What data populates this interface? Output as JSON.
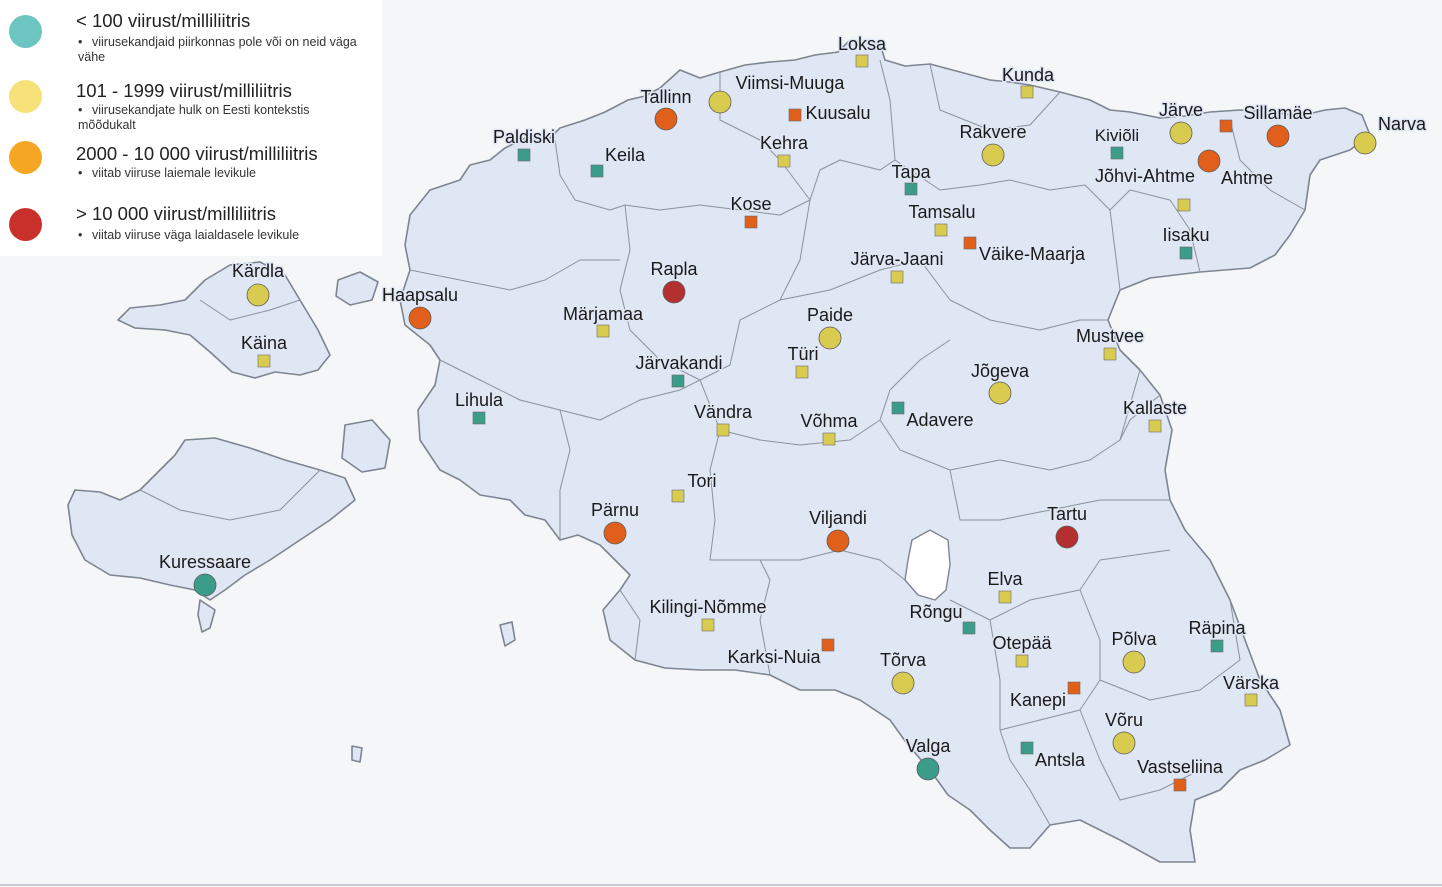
{
  "legend": {
    "items": [
      {
        "title": "< 100 viirust/milliliitris",
        "desc": "viirusekandjaid piirkonnas pole või on neid väga vähe",
        "color": "#6cc5c1"
      },
      {
        "title": "101 - 1999 viirust/milliliitris",
        "desc": "viirusekandjate hulk on Eesti kontekstis mõõdukalt",
        "color": "#f7e27a"
      },
      {
        "title": "2000 - 10 000 viirust/milliliitris",
        "desc": "viitab viiruse laiemale levikule",
        "color": "#f5a623"
      },
      {
        "title": "> 10 000 viirust/milliliitris",
        "desc": "viitab viiruse väga laialdasele levikule",
        "color": "#c9302c"
      }
    ]
  },
  "marker_colors": {
    "teal": "#3c9c8a",
    "yellow": "#d9cb4f",
    "orange": "#e05f1b",
    "red": "#b3302f"
  },
  "cities": [
    {
      "name": "Loksa",
      "marker": "square",
      "level": "yellow"
    },
    {
      "name": "Viimsi-Muuga",
      "marker": "circle",
      "level": "yellow"
    },
    {
      "name": "Kunda",
      "marker": "square",
      "level": "yellow"
    },
    {
      "name": "Tallinn",
      "marker": "circle",
      "level": "orange"
    },
    {
      "name": "Kuusalu",
      "marker": "square",
      "level": "orange"
    },
    {
      "name": "Järve",
      "marker": "circle",
      "level": "yellow"
    },
    {
      "name": "Sillamäe",
      "marker": "circle",
      "level": "orange"
    },
    {
      "name": "Narva",
      "marker": "circle",
      "level": "yellow"
    },
    {
      "name": "Paldiski",
      "marker": "square",
      "level": "teal"
    },
    {
      "name": "Kehra",
      "marker": "square",
      "level": "yellow"
    },
    {
      "name": "Rakvere",
      "marker": "circle",
      "level": "yellow"
    },
    {
      "name": "Kiviõli",
      "marker": "square",
      "level": "teal"
    },
    {
      "name": "Keila",
      "marker": "square",
      "level": "teal"
    },
    {
      "name": "Tapa",
      "marker": "square",
      "level": "teal"
    },
    {
      "name": "Jõhvi-Ahtme",
      "marker": "square",
      "level": "yellow"
    },
    {
      "name": "Ahtme",
      "marker": "circle",
      "level": "orange"
    },
    {
      "name": "Kose",
      "marker": "square",
      "level": "orange"
    },
    {
      "name": "Tamsalu",
      "marker": "square",
      "level": "yellow"
    },
    {
      "name": "Iisaku",
      "marker": "square",
      "level": "teal"
    },
    {
      "name": "Väike-Maarja",
      "marker": "square",
      "level": "orange"
    },
    {
      "name": "Järva-Jaani",
      "marker": "square",
      "level": "yellow"
    },
    {
      "name": "Rapla",
      "marker": "circle",
      "level": "red"
    },
    {
      "name": "Kärdla",
      "marker": "circle",
      "level": "yellow"
    },
    {
      "name": "Haapsalu",
      "marker": "circle",
      "level": "orange"
    },
    {
      "name": "Märjamaa",
      "marker": "square",
      "level": "yellow"
    },
    {
      "name": "Paide",
      "marker": "circle",
      "level": "yellow"
    },
    {
      "name": "Käina",
      "marker": "square",
      "level": "yellow"
    },
    {
      "name": "Mustvee",
      "marker": "square",
      "level": "yellow"
    },
    {
      "name": "Türi",
      "marker": "square",
      "level": "yellow"
    },
    {
      "name": "Järvakandi",
      "marker": "square",
      "level": "teal"
    },
    {
      "name": "Jõgeva",
      "marker": "circle",
      "level": "yellow"
    },
    {
      "name": "Lihula",
      "marker": "square",
      "level": "teal"
    },
    {
      "name": "Kallaste",
      "marker": "square",
      "level": "yellow"
    },
    {
      "name": "Vändra",
      "marker": "square",
      "level": "yellow"
    },
    {
      "name": "Adavere",
      "marker": "square",
      "level": "teal"
    },
    {
      "name": "Võhma",
      "marker": "square",
      "level": "yellow"
    },
    {
      "name": "Tori",
      "marker": "square",
      "level": "yellow"
    },
    {
      "name": "Pärnu",
      "marker": "circle",
      "level": "orange"
    },
    {
      "name": "Tartu",
      "marker": "circle",
      "level": "red"
    },
    {
      "name": "Viljandi",
      "marker": "circle",
      "level": "orange"
    },
    {
      "name": "Kuressaare",
      "marker": "circle",
      "level": "teal"
    },
    {
      "name": "Elva",
      "marker": "square",
      "level": "yellow"
    },
    {
      "name": "Kilingi-Nõmme",
      "marker": "square",
      "level": "yellow"
    },
    {
      "name": "Rõngu",
      "marker": "square",
      "level": "teal"
    },
    {
      "name": "Räpina",
      "marker": "square",
      "level": "teal"
    },
    {
      "name": "Põlva",
      "marker": "circle",
      "level": "yellow"
    },
    {
      "name": "Otepää",
      "marker": "square",
      "level": "yellow"
    },
    {
      "name": "Karksi-Nuia",
      "marker": "square",
      "level": "orange"
    },
    {
      "name": "Tõrva",
      "marker": "circle",
      "level": "yellow"
    },
    {
      "name": "Värska",
      "marker": "square",
      "level": "yellow"
    },
    {
      "name": "Kanepi",
      "marker": "square",
      "level": "orange"
    },
    {
      "name": "Võru",
      "marker": "circle",
      "level": "yellow"
    },
    {
      "name": "Valga",
      "marker": "circle",
      "level": "teal"
    },
    {
      "name": "Antsla",
      "marker": "square",
      "level": "teal"
    },
    {
      "name": "Vastseliina",
      "marker": "square",
      "level": "orange"
    }
  ]
}
